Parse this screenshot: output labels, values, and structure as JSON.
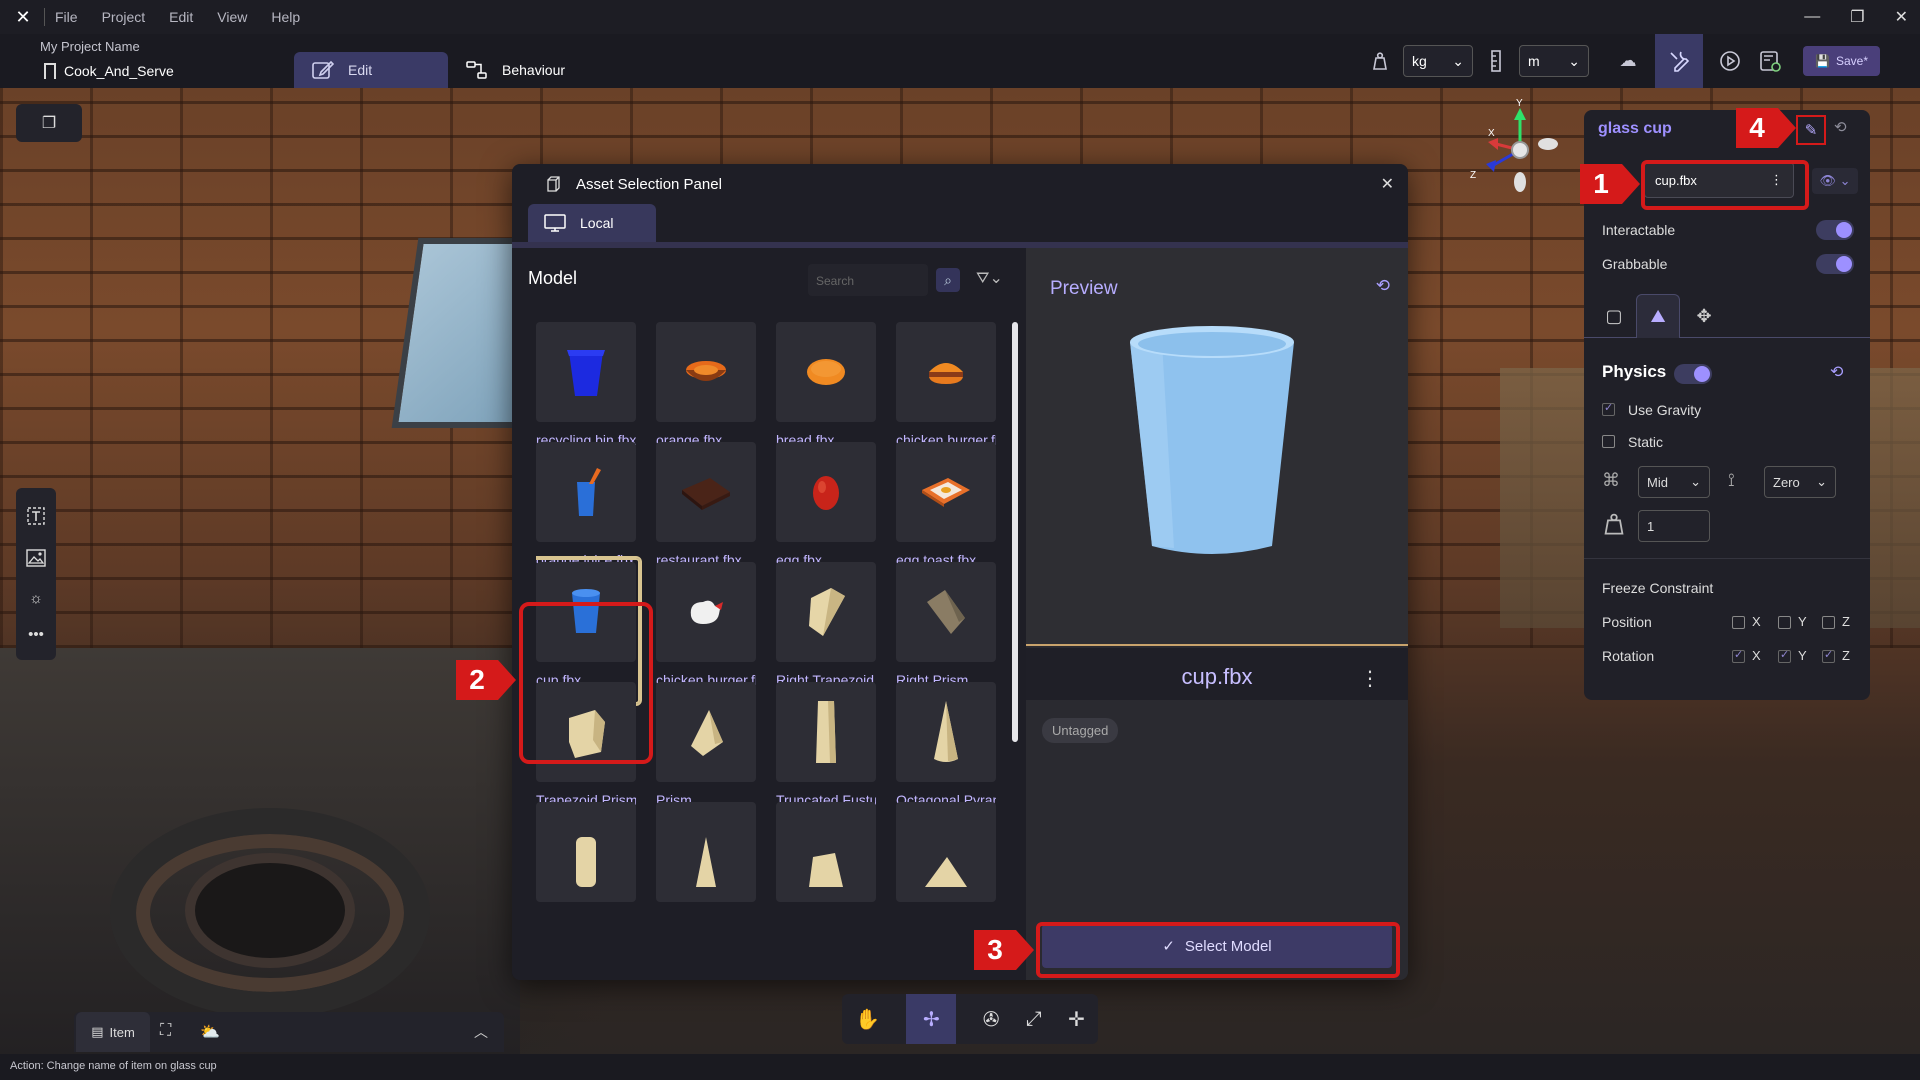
{
  "menubar": {
    "items": [
      "File",
      "Project",
      "Edit",
      "View",
      "Help"
    ]
  },
  "toolbar": {
    "project_name": "My Project Name",
    "scene_name": "Cook_And_Serve",
    "mode_edit": "Edit",
    "mode_behaviour": "Behaviour",
    "mass_unit": "kg",
    "length_unit": "m",
    "save_label": "Save*"
  },
  "asset_panel": {
    "title": "Asset Selection Panel",
    "tab_local": "Local",
    "model_title": "Model",
    "search_placeholder": "Search",
    "items": [
      {
        "label": "recycling bin.fbx"
      },
      {
        "label": "orange.fbx"
      },
      {
        "label": "bread.fbx"
      },
      {
        "label": "chicken burger.fbx"
      },
      {
        "label": "orange juice.fbx"
      },
      {
        "label": "restaurant.fbx"
      },
      {
        "label": "egg.fbx"
      },
      {
        "label": "egg toast.fbx"
      },
      {
        "label": "cup.fbx"
      },
      {
        "label": "chicken burger.fbx"
      },
      {
        "label": "Right Trapezoid"
      },
      {
        "label": "Right Prism"
      },
      {
        "label": "Trapezoid Prism"
      },
      {
        "label": "Prism"
      },
      {
        "label": "Truncated Fustum"
      },
      {
        "label": "Octagonal Pyramid"
      }
    ],
    "preview_label": "Preview",
    "preview_name": "cup.fbx",
    "tag": "Untagged",
    "select_button": "Select Model"
  },
  "inspector": {
    "title": "glass cup",
    "model_field": "cup.fbx",
    "interactable_label": "Interactable",
    "grabbable_label": "Grabbable",
    "physics_title": "Physics",
    "use_gravity_label": "Use Gravity",
    "static_label": "Static",
    "collision_select": "Mid",
    "damping_select": "Zero",
    "mass_value": "1",
    "freeze_title": "Freeze Constraint",
    "position_label": "Position",
    "rotation_label": "Rotation",
    "axis_x": "X",
    "axis_y": "Y",
    "axis_z": "Z"
  },
  "gizmo": {
    "x": "X",
    "y": "Y",
    "z": "Z"
  },
  "bottom": {
    "item_tab": "Item"
  },
  "status": {
    "text": "Action: Change name of item on glass cup"
  },
  "callouts": {
    "one": "1",
    "two": "2",
    "three": "3",
    "four": "4"
  },
  "colors": {
    "accent": "#9d90ff",
    "highlight": "#d51a1a"
  }
}
